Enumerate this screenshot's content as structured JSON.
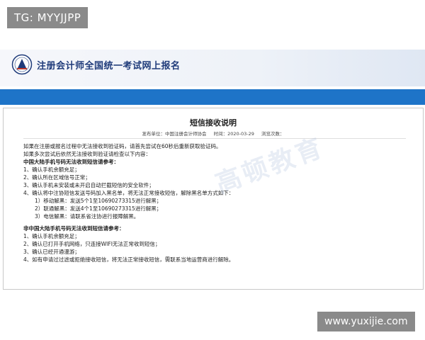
{
  "overlay": {
    "tg_tag": "TG: MYYJJPP",
    "site_tag": "www.yuxijie.com"
  },
  "header": {
    "site_title": "注册会计师全国统一考试网上报名"
  },
  "article": {
    "title": "短信接收说明",
    "meta": {
      "publisher": "发布单位：中国注册会计师协会",
      "time": "时间：2020-03-29",
      "views": "浏览次数："
    },
    "lines": [
      "如果在注册或报名过程中无法接收到验证码，请首先尝试在60秒后重新获取验证码。",
      "如果多次尝试后依然无法接收到验证请检查以下内容：",
      "中国大陆手机号码无法收到短信请参考：",
      "1、确认手机余额充足；",
      "2、确认所在区域信号正常；",
      "3、确认手机未安装或未开启自动拦截短信的安全软件；",
      "4、确认将中注协短信发送号码加入黑名单，将无法正常接收短信，解除黑名单方式如下：",
      "1）移动解黑：发送5个1至10690273315进行解黑；",
      "2）联通解黑：发送4个1至10690273315进行解黑；",
      "3）电信解黑：请联系省注协进行报障解黑。",
      "非中国大陆手机号码无法收到短信请参考：",
      "1、确认手机余额充足；",
      "2、确认已打开手机网络，只连接WIFI无法正常收到短信；",
      "3、确认已经开通漫游；",
      "4、如有申请过过滤或拒绝接收短信，将无法正常接收短信，需联系当地运营商进行解除。"
    ]
  },
  "watermark": "高顿教育"
}
